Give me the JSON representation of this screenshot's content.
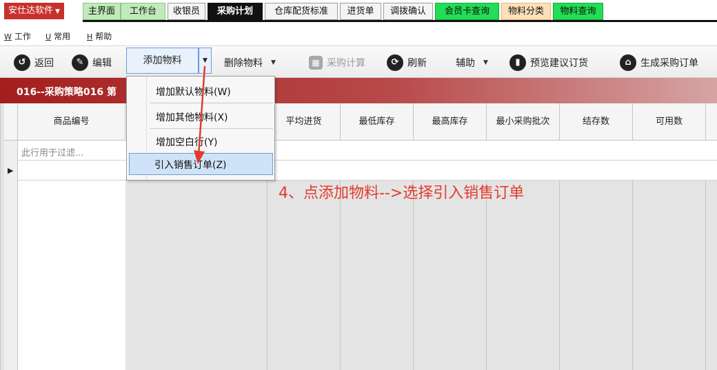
{
  "topbar": {
    "brand": "安仕达软件",
    "tabs": [
      {
        "label": "主界面"
      },
      {
        "label": "工作台"
      },
      {
        "label": "收银员"
      },
      {
        "label": "采购计划"
      },
      {
        "label": "仓库配货标准"
      },
      {
        "label": "进货单"
      },
      {
        "label": "调拨确认"
      },
      {
        "label": "会员卡查询"
      },
      {
        "label": "物料分类"
      },
      {
        "label": "物料查询"
      }
    ]
  },
  "menubar": {
    "items": [
      {
        "accel": "W",
        "label": "工作"
      },
      {
        "accel": "U",
        "label": "常用"
      },
      {
        "accel": "H",
        "label": "帮助"
      }
    ]
  },
  "toolbar": {
    "back": "返回",
    "edit": "编辑",
    "add_material": "添加物料",
    "delete_material": "删除物料",
    "purchase_calc": "采购计算",
    "refresh": "刷新",
    "assist": "辅助",
    "preview_suggest": "预览建议订货",
    "generate_po": "生成采购订单"
  },
  "title_band": {
    "text": "016--采购策略016 第"
  },
  "grid": {
    "headers": [
      "商品编号",
      "",
      "平均进货",
      "最低库存",
      "最高库存",
      "最小采购批次",
      "结存数",
      "可用数"
    ],
    "filter_placeholder": "此行用于过滤..."
  },
  "dropdown": {
    "items": [
      {
        "label": "增加默认物料(W)"
      },
      {
        "label": "增加其他物料(X)"
      },
      {
        "label": "增加空白行(Y)"
      },
      {
        "label": "引入销售订单(Z)"
      }
    ]
  },
  "annotation": {
    "text": "4、点添加物料-->选择引入销售订单",
    "color": "#e43a2e"
  },
  "colors": {
    "brand_red": "#c8302c",
    "active_tab": "#111111",
    "lime_tab": "#22dd55",
    "highlight": "#cfe3f8"
  }
}
